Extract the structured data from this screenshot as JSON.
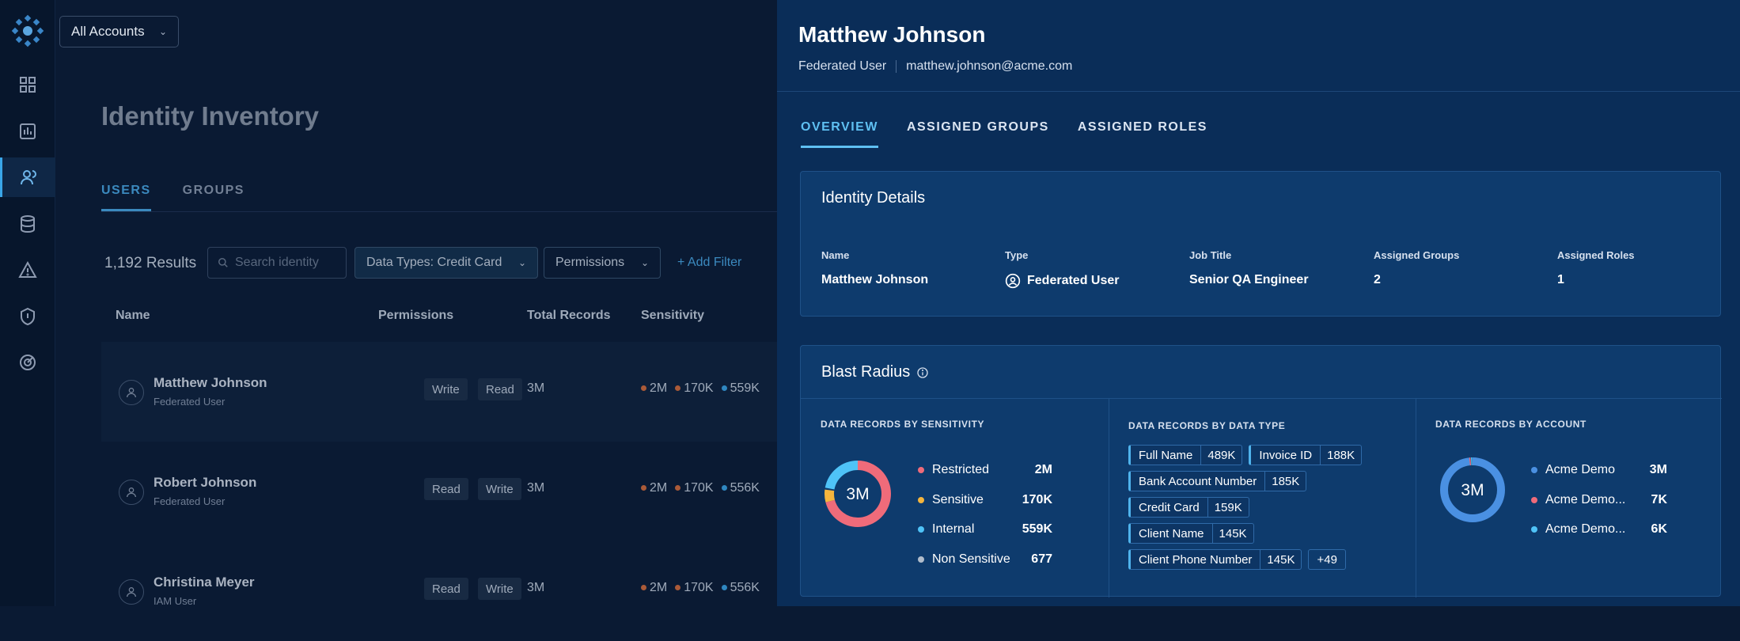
{
  "topbar": {
    "account_select": "All Accounts"
  },
  "main": {
    "title": "Identity Inventory",
    "tabs": [
      {
        "label": "USERS"
      },
      {
        "label": "GROUPS"
      }
    ],
    "results": "1,192 Results",
    "search_placeholder": "Search identity",
    "filters": {
      "data_types": "Data Types: Credit Card",
      "permissions": "Permissions",
      "add_filter": "+ Add Filter"
    },
    "columns": [
      "Name",
      "Permissions",
      "Total Records",
      "Sensitivity"
    ],
    "rows": [
      {
        "name": "Matthew Johnson",
        "type": "Federated User",
        "perms": [
          "Write",
          "Read"
        ],
        "records": "3M",
        "sens": [
          "2M",
          "170K",
          "559K"
        ]
      },
      {
        "name": "Robert Johnson",
        "type": "Federated User",
        "perms": [
          "Read",
          "Write"
        ],
        "records": "3M",
        "sens": [
          "2M",
          "170K",
          "556K"
        ]
      },
      {
        "name": "Christina Meyer",
        "type": "IAM User",
        "perms": [
          "Read",
          "Write"
        ],
        "records": "3M",
        "sens": [
          "2M",
          "170K",
          "556K"
        ]
      }
    ]
  },
  "panel": {
    "name": "Matthew Johnson",
    "type": "Federated User",
    "email": "matthew.johnson@acme.com",
    "tabs": [
      {
        "label": "OVERVIEW"
      },
      {
        "label": "ASSIGNED GROUPS"
      },
      {
        "label": "ASSIGNED ROLES"
      }
    ],
    "identity_details": {
      "title": "Identity Details",
      "fields": [
        {
          "label": "Name",
          "value": "Matthew Johnson"
        },
        {
          "label": "Type",
          "value": "Federated User"
        },
        {
          "label": "Job Title",
          "value": "Senior QA Engineer"
        },
        {
          "label": "Assigned Groups",
          "value": "2"
        },
        {
          "label": "Assigned Roles",
          "value": "1"
        }
      ]
    },
    "blast_radius": {
      "title": "Blast Radius",
      "by_sensitivity": {
        "label": "DATA RECORDS BY SENSITIVITY",
        "total": "3M",
        "items": [
          {
            "name": "Restricted",
            "value": "2M",
            "color": "#ef6b7a"
          },
          {
            "name": "Sensitive",
            "value": "170K",
            "color": "#f5b53d"
          },
          {
            "name": "Internal",
            "value": "559K",
            "color": "#4fc3f7"
          },
          {
            "name": "Non Sensitive",
            "value": "677",
            "color": "#b0bccb"
          }
        ]
      },
      "by_data_type": {
        "label": "DATA RECORDS BY DATA TYPE",
        "rows": [
          [
            {
              "name": "Full Name",
              "count": "489K"
            },
            {
              "name": "Invoice ID",
              "count": "188K"
            }
          ],
          [
            {
              "name": "Bank Account Number",
              "count": "185K"
            }
          ],
          [
            {
              "name": "Credit Card",
              "count": "159K"
            }
          ],
          [
            {
              "name": "Client Name",
              "count": "145K"
            }
          ],
          [
            {
              "name": "Client Phone Number",
              "count": "145K"
            }
          ]
        ],
        "more": "+49"
      },
      "by_account": {
        "label": "DATA RECORDS BY ACCOUNT",
        "total": "3M",
        "items": [
          {
            "name": "Acme Demo",
            "value": "3M",
            "color": "#4a90e2"
          },
          {
            "name": "Acme Demo...",
            "value": "7K",
            "color": "#ef6b7a"
          },
          {
            "name": "Acme Demo...",
            "value": "6K",
            "color": "#4fc3f7"
          }
        ]
      }
    }
  }
}
